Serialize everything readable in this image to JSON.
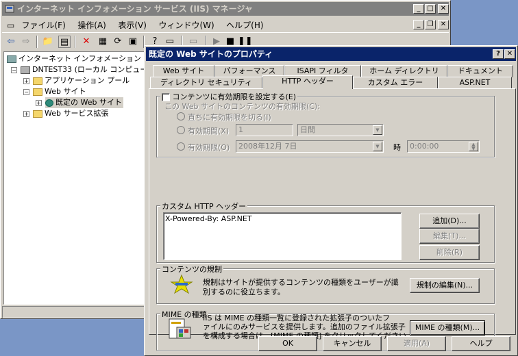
{
  "main_window": {
    "title": "インターネット インフォメーション サービス (IIS) マネージャ",
    "menu": [
      "ファイル(F)",
      "操作(A)",
      "表示(V)",
      "ウィンドウ(W)",
      "ヘルプ(H)"
    ],
    "tree": {
      "root": "インターネット インフォメーション サービス",
      "server": "DNTEST33 (ローカル コンピュータ)",
      "app_pools": "アプリケーション プール",
      "websites": "Web サイト",
      "default_site": "既定の Web サイト",
      "web_ext": "Web サービス拡張"
    }
  },
  "dialog": {
    "title": "既定の Web サイトのプロパティ",
    "tabs_row1": [
      "Web サイト",
      "パフォーマンス",
      "ISAPI フィルタ",
      "ホーム ディレクトリ",
      "ドキュメント"
    ],
    "tabs_row2": [
      "ディレクトリ セキュリティ",
      "HTTP ヘッダー",
      "カスタム エラー",
      "ASP.NET"
    ],
    "expire": {
      "checkbox_label": "コンテンツに有効期限を設定する(E)",
      "subtitle": "この Web サイトのコンテンツの有効期限(C):",
      "opt_immediate": "直ちに有効期限を切る(I)",
      "opt_period": "有効期間(X)",
      "period_value": "1",
      "period_unit": "日間",
      "opt_date": "有効期限(O)",
      "date_value": "2008年12月 7日",
      "time_label": "時",
      "time_value": "0:00:00"
    },
    "custom_headers": {
      "label": "カスタム HTTP ヘッダー",
      "items": [
        "X-Powered-By: ASP.NET"
      ],
      "add": "追加(D)...",
      "edit": "編集(T)...",
      "remove": "削除(R)"
    },
    "rating": {
      "label": "コンテンツの規制",
      "desc1": "規制はサイトが提供するコンテンツの種類をユーザーが識",
      "desc2": "別するのに役立ちます。",
      "button": "規制の編集(N)..."
    },
    "mime": {
      "label": "MIME の種類",
      "desc1": "IIS は MIME の種類一覧に登録された拡張子のついたフ",
      "desc2": "ァイルにのみサービスを提供します。追加のファイル拡張子",
      "desc3": "を構成する場合は、[MIME の種類] をクリックしてください。",
      "button": "MIME の種類(M)..."
    },
    "buttons": {
      "ok": "OK",
      "cancel": "キャンセル",
      "apply": "適用(A)",
      "help": "ヘルプ"
    }
  }
}
